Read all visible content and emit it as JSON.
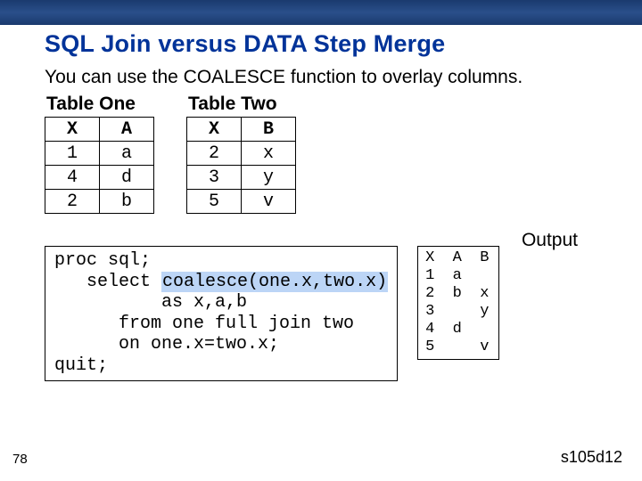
{
  "title": "SQL Join versus DATA Step Merge",
  "description": "You can use the COALESCE function to overlay columns.",
  "table_one": {
    "title": "Table One",
    "headers": [
      "X",
      "A"
    ],
    "rows": [
      [
        "1",
        "a"
      ],
      [
        "4",
        "d"
      ],
      [
        "2",
        "b"
      ]
    ]
  },
  "table_two": {
    "title": "Table Two",
    "headers": [
      "X",
      "B"
    ],
    "rows": [
      [
        "2",
        "x"
      ],
      [
        "3",
        "y"
      ],
      [
        "5",
        "v"
      ]
    ]
  },
  "output_label": "Output",
  "code": {
    "l1": "proc sql;",
    "l2a": "   select ",
    "l2b": "coalesce(one.x,two.x)",
    "l3": "          as x,a,b",
    "l4": "      from one full join two",
    "l5": "      on one.x=two.x;",
    "l6": "quit;"
  },
  "output_text": "X  A  B\n1  a\n2  b  x\n3     y\n4  d\n5     v",
  "page_number": "78",
  "slide_id": "s105d12",
  "chart_data": [
    {
      "type": "table",
      "title": "Table One",
      "columns": [
        "X",
        "A"
      ],
      "rows": [
        [
          1,
          "a"
        ],
        [
          4,
          "d"
        ],
        [
          2,
          "b"
        ]
      ]
    },
    {
      "type": "table",
      "title": "Table Two",
      "columns": [
        "X",
        "B"
      ],
      "rows": [
        [
          2,
          "x"
        ],
        [
          3,
          "y"
        ],
        [
          5,
          "v"
        ]
      ]
    },
    {
      "type": "table",
      "title": "Output",
      "columns": [
        "X",
        "A",
        "B"
      ],
      "rows": [
        [
          1,
          "a",
          null
        ],
        [
          2,
          "b",
          "x"
        ],
        [
          3,
          null,
          "y"
        ],
        [
          4,
          "d",
          null
        ],
        [
          5,
          null,
          "v"
        ]
      ]
    }
  ]
}
